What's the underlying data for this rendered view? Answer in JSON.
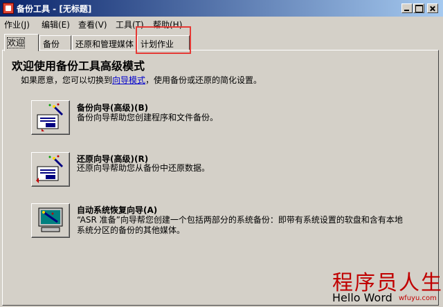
{
  "window": {
    "title": "备份工具 - [无标题]"
  },
  "menu": [
    "作业(J)",
    "编辑(E)",
    "查看(V)",
    "工具(T)",
    "帮助(H)"
  ],
  "tabs": [
    {
      "label": "欢迎",
      "active": true
    },
    {
      "label": "备份",
      "active": false
    },
    {
      "label": "还原和管理媒体",
      "active": false
    },
    {
      "label": "计划作业",
      "active": false
    }
  ],
  "welcome": {
    "heading": "欢迎使用备份工具高级模式",
    "intro_before": "如果愿意，您可以切换到",
    "intro_link": "向导模式",
    "intro_after": "，使用备份或还原的简化设置。"
  },
  "wizards": [
    {
      "title": "备份向导(高级)(B)",
      "desc": [
        "备份向导帮助您创建程序和文件备份。"
      ],
      "icon": "backup-wizard-icon"
    },
    {
      "title": "还原向导(高级)(R)",
      "desc": [
        "还原向导帮助您从备份中还原数据。"
      ],
      "icon": "restore-wizard-icon"
    },
    {
      "title": "自动系统恢复向导(A)",
      "desc": [
        "“ASR 准备”向导帮您创建一个包括两部分的系统备份：即带有系统设置的软盘和含有本地",
        "系统分区的备份的其他媒体。"
      ],
      "icon": "asr-wizard-icon"
    }
  ],
  "watermark": {
    "cn": "程序员人生",
    "en": "Hello Word",
    "url": "wfuyu.com"
  }
}
